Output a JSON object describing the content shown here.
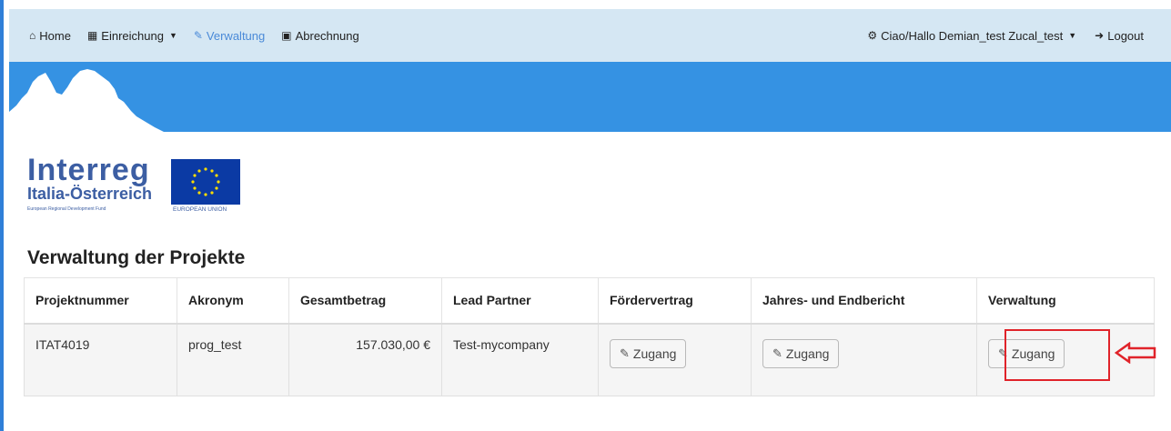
{
  "nav": {
    "home": "Home",
    "einreichung": "Einreichung",
    "verwaltung": "Verwaltung",
    "abrechnung": "Abrechnung",
    "user": "Ciao/Hallo Demian_test Zucal_test",
    "logout": "Logout"
  },
  "logo": {
    "line1": "Interreg",
    "line2": "Italia-Österreich",
    "line3": "European Regional Development Fund",
    "eu": "EUROPEAN UNION"
  },
  "page_title": "Verwaltung der Projekte",
  "table": {
    "headers": [
      "Projektnummer",
      "Akronym",
      "Gesamtbetrag",
      "Lead Partner",
      "Fördervertrag",
      "Jahres- und Endbericht",
      "Verwaltung"
    ],
    "rows": [
      {
        "projektnummer": "ITAT4019",
        "akronym": "prog_test",
        "gesamtbetrag": "157.030,00 €",
        "lead_partner": "Test-mycompany",
        "foerdervertrag_btn": "Zugang",
        "bericht_btn": "Zugang",
        "verwaltung_btn": "Zugang"
      }
    ]
  },
  "colors": {
    "navbar": "#d5e7f3",
    "banner": "#3592e3",
    "highlight": "#e0232a",
    "eu_blue": "#0b3aa4",
    "eu_stars": "#ffdd00",
    "logo_blue": "#3c5ea3"
  }
}
